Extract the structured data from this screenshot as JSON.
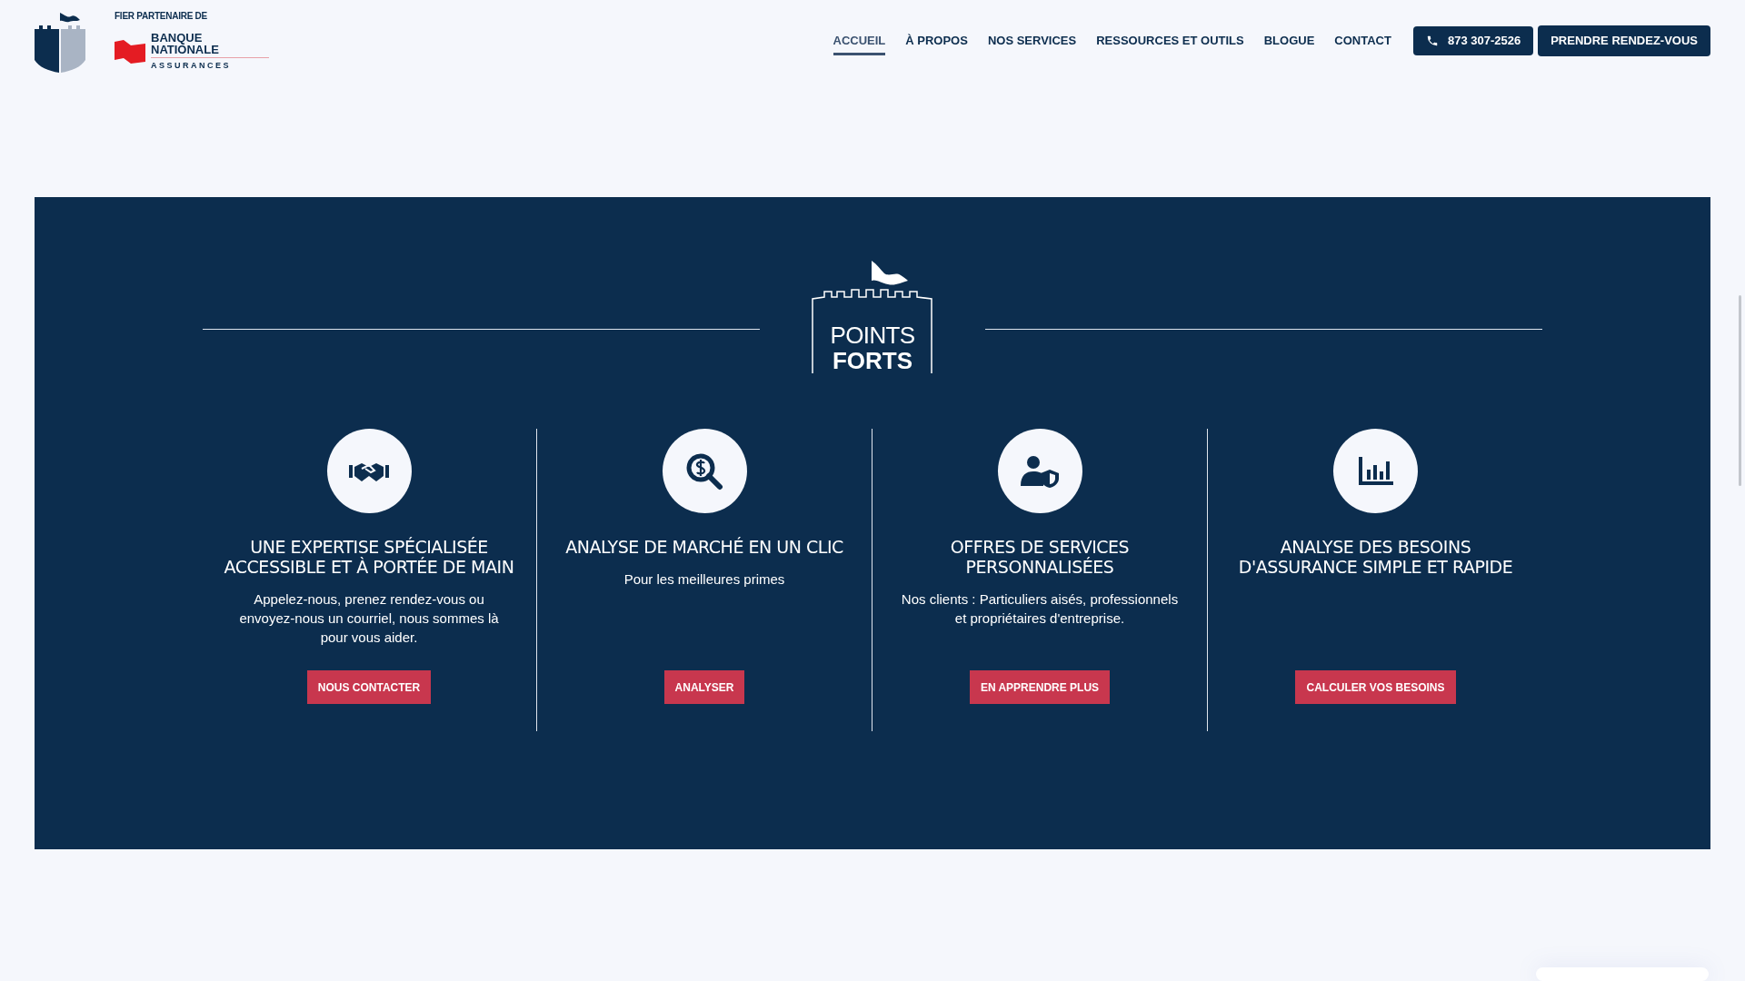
{
  "header": {
    "partner_label": "FIER PARTENAIRE DE",
    "bank_name": [
      "BANQUE",
      "NATIONALE"
    ],
    "bank_division": "ASSURANCES",
    "nav": [
      {
        "label": "ACCUEIL",
        "selected": true
      },
      {
        "label": "À PROPOS",
        "selected": false
      },
      {
        "label": "NOS SERVICES",
        "selected": false
      },
      {
        "label": "RESSOURCES ET OUTILS",
        "selected": false
      },
      {
        "label": "BLOGUE",
        "selected": false
      },
      {
        "label": "CONTACT",
        "selected": false
      }
    ],
    "phone_button": "873 307-2526",
    "appointment_button": "PRENDRE RENDEZ-VOUS"
  },
  "section": {
    "title_light": "POINTS",
    "title_bold": "FORTS",
    "features": [
      {
        "heading": [
          "UNE EXPERTISE SPÉCIALISÉE",
          "ACCESSIBLE ET À PORTÉE DE MAIN"
        ],
        "description": "Appelez-nous, prenez rendez-vous ou envoyez-nous un courriel, nous sommes là pour vous aider.",
        "button": "NOUS CONTACTER"
      },
      {
        "heading": [
          "ANALYSE DE MARCHÉ EN UN CLIC"
        ],
        "description": "Pour les meilleures primes",
        "button": "ANALYSER"
      },
      {
        "heading": [
          "OFFRES DE SERVICES",
          "PERSONNALISÉES"
        ],
        "description": "Nos clients : Particuliers aisés, professionnels et propriétaires d'entreprise.",
        "button": "EN APPRENDRE PLUS"
      },
      {
        "heading": [
          "ANALYSE DES BESOINS",
          "D'ASSURANCE SIMPLE ET RAPIDE"
        ],
        "button": "CALCULER VOS BESOINS"
      }
    ]
  }
}
